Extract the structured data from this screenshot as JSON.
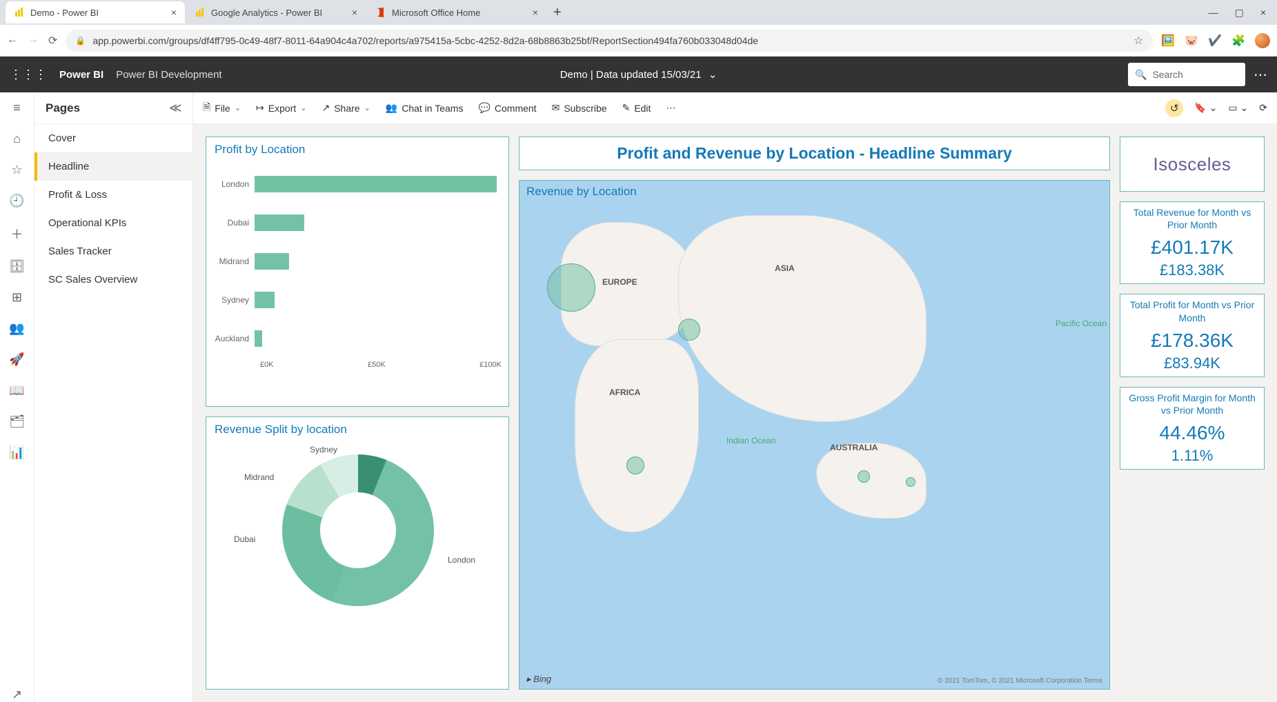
{
  "browser": {
    "tabs": [
      {
        "label": "Demo - Power BI",
        "active": true
      },
      {
        "label": "Google Analytics - Power BI",
        "active": false
      },
      {
        "label": "Microsoft Office Home",
        "active": false
      }
    ],
    "url": "app.powerbi.com/groups/df4ff795-0c49-48f7-8011-64a904c4a702/reports/a975415a-5cbc-4252-8d2a-68b8863b25bf/ReportSection494fa760b033048d04de"
  },
  "pbi": {
    "brand": "Power BI",
    "workspace": "Power BI Development",
    "center": "Demo  |  Data updated 15/03/21",
    "search_placeholder": "Search"
  },
  "actions": {
    "file": "File",
    "export": "Export",
    "share": "Share",
    "chat": "Chat in Teams",
    "comment": "Comment",
    "subscribe": "Subscribe",
    "edit": "Edit"
  },
  "pages": {
    "title": "Pages",
    "items": [
      "Cover",
      "Headline",
      "Profit & Loss",
      "Operational KPIs",
      "Sales Tracker",
      "SC Sales Overview"
    ],
    "active_index": 1
  },
  "report": {
    "headline_title": "Profit and Revenue by Location - Headline Summary",
    "bar_title": "Profit by Location",
    "donut_title": "Revenue Split by location",
    "map_title": "Revenue by Location",
    "map_labels": {
      "europe": "EUROPE",
      "africa": "AFRICA",
      "asia": "ASIA",
      "australia": "AUSTRALIA",
      "indian": "Indian Ocean",
      "pacific": "Pacific Ocean"
    },
    "map_credit": "© 2021 TomTom, © 2021 Microsoft Corporation  Terms",
    "bing": "Bing",
    "logo": "Isosceles",
    "kpis": [
      {
        "label": "Total Revenue for Month vs Prior Month",
        "big": "£401.17K",
        "small": "£183.38K"
      },
      {
        "label": "Total Profit for Month vs Prior Month",
        "big": "£178.36K",
        "small": "£83.94K"
      },
      {
        "label": "Gross Profit Margin for Month vs Prior Month",
        "big": "44.46%",
        "small": "1.11%"
      }
    ],
    "donut_labels": {
      "london": "London",
      "dubai": "Dubai",
      "midrand": "Midrand",
      "sydney": "Sydney"
    },
    "axis_ticks": [
      "£0K",
      "£50K",
      "£100K"
    ]
  },
  "chart_data": [
    {
      "type": "bar",
      "title": "Profit by Location",
      "orientation": "horizontal",
      "categories": [
        "London",
        "Dubai",
        "Midrand",
        "Sydney",
        "Auckland"
      ],
      "values": [
        108000,
        22000,
        15000,
        9000,
        3000
      ],
      "xlabel": "",
      "ylabel": "",
      "xlim": [
        0,
        110000
      ],
      "ticks": [
        0,
        50000,
        100000
      ]
    },
    {
      "type": "pie",
      "title": "Revenue Split by location",
      "categories": [
        "London",
        "Dubai",
        "Midrand",
        "Sydney",
        "Auckland"
      ],
      "values": [
        50,
        25,
        13,
        8,
        4
      ],
      "donut": true
    }
  ]
}
